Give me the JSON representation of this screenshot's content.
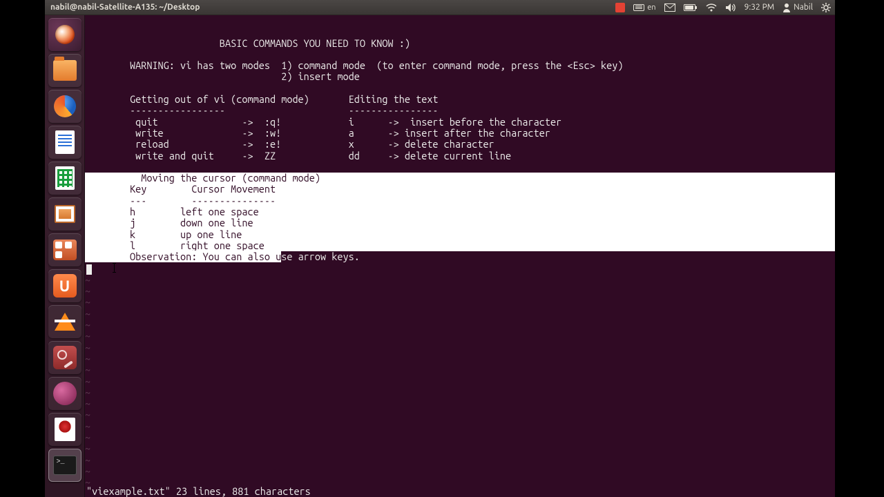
{
  "menubar": {
    "title": "nabil@nabil-Satellite-A135: ~/Desktop",
    "keyboard_lang": "en",
    "time": "9:32 PM",
    "username": "Nabil"
  },
  "launcher": {
    "items": [
      {
        "name": "dash-home"
      },
      {
        "name": "files"
      },
      {
        "name": "firefox"
      },
      {
        "name": "libreoffice-writer"
      },
      {
        "name": "libreoffice-calc"
      },
      {
        "name": "libreoffice-impress"
      },
      {
        "name": "software-center"
      },
      {
        "name": "ubuntu-one"
      },
      {
        "name": "vlc"
      },
      {
        "name": "system-settings"
      },
      {
        "name": "cheese-webcam"
      },
      {
        "name": "evince-pdf"
      },
      {
        "name": "terminal"
      }
    ]
  },
  "terminal": {
    "lines_top": [
      "                        BASIC COMMANDS YOU NEED TO KNOW :)",
      "",
      "        WARNING: vi has two modes  1) command mode  (to enter command mode, press the <Esc> key)",
      "                                   2) insert mode",
      "",
      "        Getting out of vi (command mode)       Editing the text",
      "        -----------------                      ----------------",
      "         quit               ->  :q!            i      ->  insert before the character",
      "         write              ->  :w!            a      -> insert after the character",
      "         reload             ->  :e!            x      -> delete character",
      "         write and quit     ->  ZZ             dd     -> delete current line",
      ""
    ],
    "selected_block": "          Moving the cursor (command mode)\n        Key        Cursor Movement\n        ---        ---------------\n        h        left one space\n        j        down one line\n        k        up one line\n        l        right one space",
    "sel_tail_prefix": "        Observation: You can also u",
    "sel_tail_suffix": "se arrow keys.",
    "tilde_count": 19,
    "status": "\"viexample.txt\" 23 lines, 881 characters"
  }
}
